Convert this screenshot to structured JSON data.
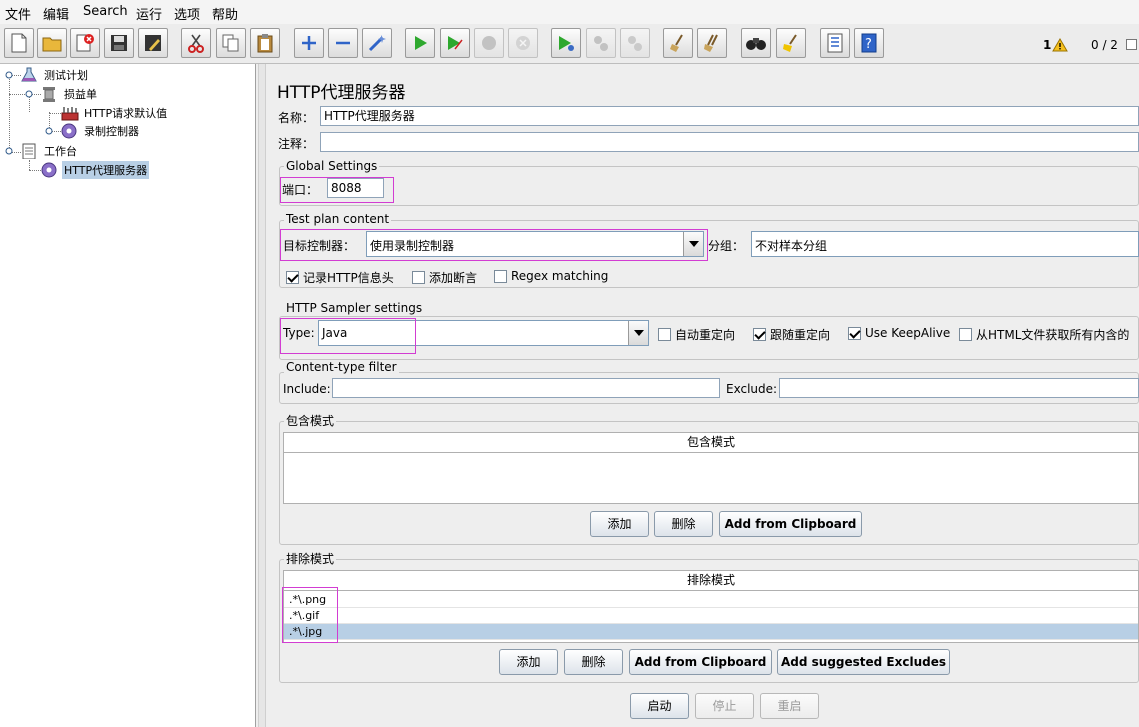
{
  "menu": [
    "文件",
    "编辑",
    "Search",
    "运行",
    "选项",
    "帮助"
  ],
  "toolbar": {
    "buttons": [
      "new",
      "open",
      "close",
      "save",
      "save-as-test-fragment",
      "cut",
      "copy",
      "paste",
      "expand-all",
      "collapse-all",
      "toggle",
      "start",
      "start-no-pauses",
      "stop",
      "shutdown",
      "remote-start-all",
      "remote-stop-all",
      "remote-shutdown-all",
      "clear",
      "clear-all",
      "search",
      "reset-search",
      "function-helper",
      "help"
    ],
    "warning_count": "1",
    "threads": "0 / 2"
  },
  "tree": {
    "nodes": [
      {
        "label": "测试计划",
        "icon": "flask-icon"
      },
      {
        "label": "损益单",
        "icon": "spool-icon"
      },
      {
        "label": "HTTP请求默认值",
        "icon": "config-tools-icon"
      },
      {
        "label": "录制控制器",
        "icon": "gear-icon"
      },
      {
        "label": "工作台",
        "icon": "clipboard-icon"
      },
      {
        "label": "HTTP代理服务器",
        "icon": "gear-icon"
      }
    ]
  },
  "panel": {
    "title": "HTTP代理服务器",
    "name_label": "名称：",
    "name_value": "HTTP代理服务器",
    "comment_label": "注释：",
    "comment_value": "",
    "global": {
      "legend": "Global Settings",
      "port_label": "端口：",
      "port_value": "8088"
    },
    "test_plan": {
      "legend": "Test plan content",
      "target_label": "目标控制器：",
      "target_value": "使用录制控制器",
      "group_label": "分组：",
      "group_value": "不对样本分组",
      "checks": [
        {
          "label": "记录HTTP信息头",
          "checked": true
        },
        {
          "label": "添加断言",
          "checked": false
        },
        {
          "label": "Regex matching",
          "checked": false
        }
      ]
    },
    "sampler": {
      "legend": "HTTP Sampler settings",
      "type_label": "Type:",
      "type_value": "Java",
      "checks": [
        {
          "label": "自动重定向",
          "checked": false
        },
        {
          "label": "跟随重定向",
          "checked": true
        },
        {
          "label": "Use KeepAlive",
          "checked": true
        },
        {
          "label": "从HTML文件获取所有内含的",
          "checked": false
        }
      ]
    },
    "content_type": {
      "legend": "Content-type filter",
      "include_label": "Include:",
      "include_value": "",
      "exclude_label": "Exclude:",
      "exclude_value": ""
    },
    "include_patterns": {
      "legend": "包含模式",
      "header": "包含模式",
      "rows": [],
      "buttons": [
        "添加",
        "删除",
        "Add from Clipboard"
      ]
    },
    "exclude_patterns": {
      "legend": "排除模式",
      "header": "排除模式",
      "rows": [
        ".*\\.png",
        ".*\\.gif",
        ".*\\.jpg"
      ],
      "selected_row": 2,
      "buttons": [
        "添加",
        "删除",
        "Add from Clipboard",
        "Add suggested Excludes"
      ]
    },
    "control_buttons": [
      {
        "label": "启动",
        "enabled": true
      },
      {
        "label": "停止",
        "enabled": false
      },
      {
        "label": "重启",
        "enabled": false
      }
    ]
  },
  "colors": {
    "highlight": "#d23cd2",
    "selection": "#b8cfe5"
  }
}
